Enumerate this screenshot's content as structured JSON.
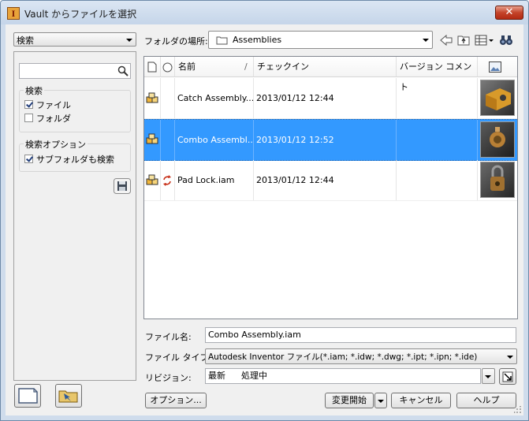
{
  "window": {
    "title": "Vault からファイルを選択",
    "app_icon_letter": "I",
    "close_glyph": "✕"
  },
  "left": {
    "search_combo": "検索",
    "search_placeholder": "",
    "group_search": {
      "title": "検索",
      "file_label": "ファイル",
      "file_checked": true,
      "folder_label": "フォルダ",
      "folder_checked": false
    },
    "group_options": {
      "title": "検索オプション",
      "subfolder_label": "サブフォルダも検索",
      "subfolder_checked": true
    }
  },
  "location": {
    "label": "フォルダの場所:",
    "value": "Assemblies"
  },
  "list": {
    "columns": {
      "name": "名前",
      "sort": "/",
      "checkin": "チェックイン",
      "version_comment": "バージョン コメント"
    },
    "rows": [
      {
        "name": "Catch Assembly...",
        "checkin": "2013/01/12 12:44",
        "comment": "",
        "selected": false,
        "status": ""
      },
      {
        "name": "Combo Assembl...",
        "checkin": "2013/01/12 12:52",
        "comment": "",
        "selected": true,
        "status": ""
      },
      {
        "name": "Pad Lock.iam",
        "checkin": "2013/01/12 12:44",
        "comment": "",
        "selected": false,
        "status": "refresh-icon"
      }
    ]
  },
  "form": {
    "filename_label": "ファイル名:",
    "filename_value": "Combo Assembly.iam",
    "filetype_label": "ファイル タイプ:",
    "filetype_value": "Autodesk Inventor ファイル(*.iam; *.idw; *.dwg; *.ipt; *.ipn; *.ide)",
    "revision_label": "リビジョン:",
    "revision_value": "最新",
    "revision_status": "処理中"
  },
  "buttons": {
    "options": "オプション...",
    "open_change": "変更開始",
    "cancel": "キャンセル",
    "help": "ヘルプ"
  },
  "colors": {
    "selection": "#3399ff",
    "title_bg": "#cfdcec"
  }
}
